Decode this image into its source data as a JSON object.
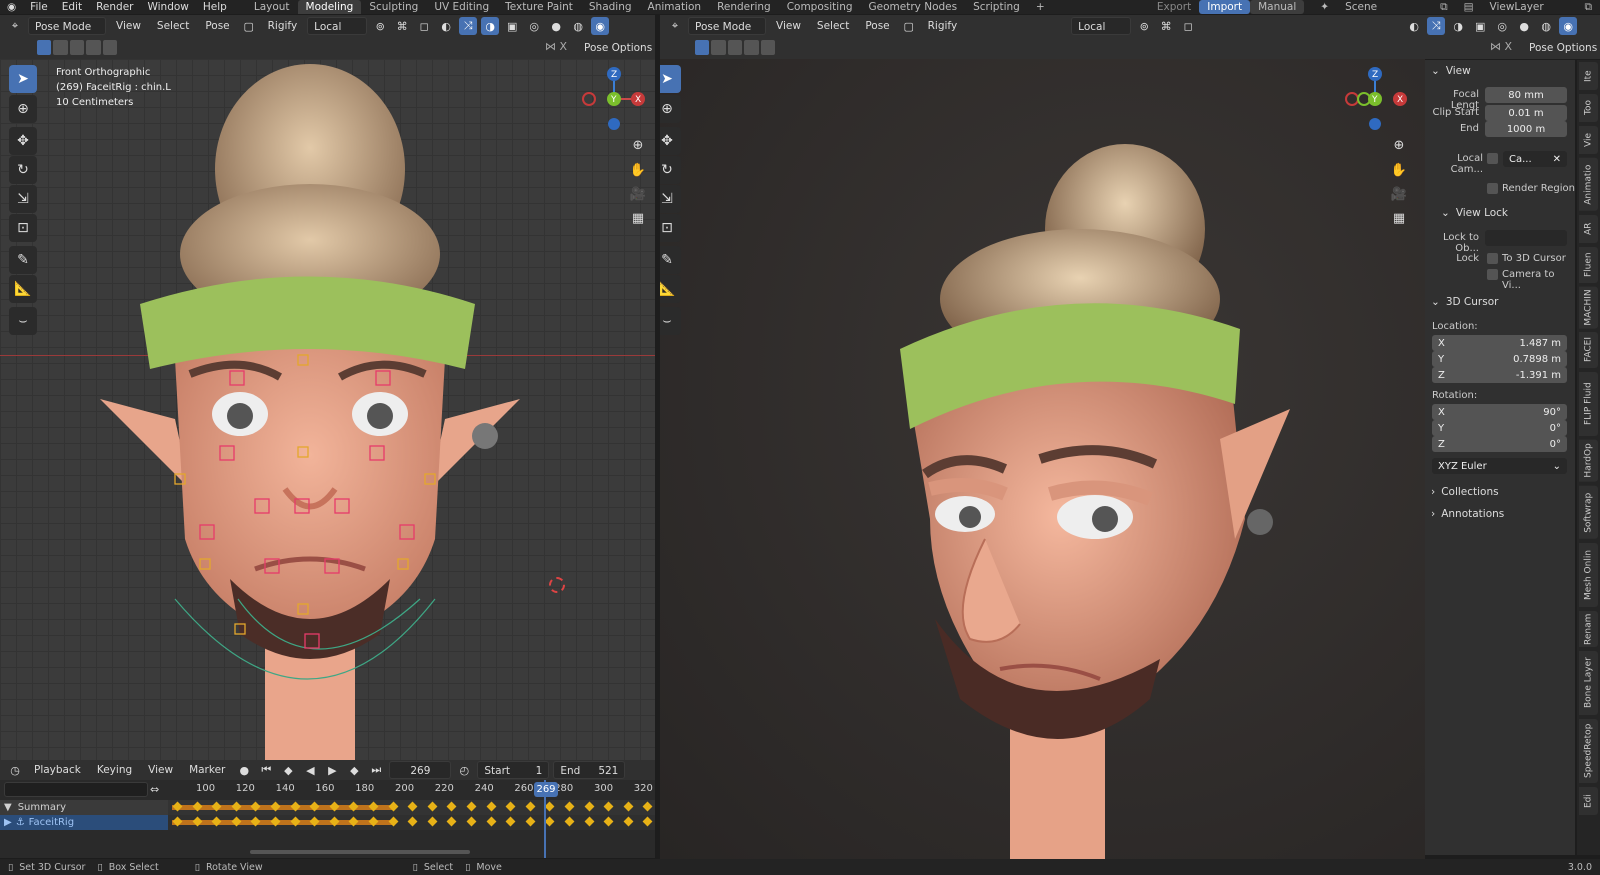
{
  "topbar": {
    "menus": [
      "File",
      "Edit",
      "Render",
      "Window",
      "Help"
    ],
    "workspaces": [
      "Layout",
      "Modeling",
      "Sculpting",
      "UV Editing",
      "Texture Paint",
      "Shading",
      "Animation",
      "Rendering",
      "Compositing",
      "Geometry Nodes",
      "Scripting"
    ],
    "active_workspace": "Modeling",
    "add": "+",
    "export": "Export",
    "import": "Import",
    "manual": "Manual",
    "scene": "Scene",
    "viewlayer": "ViewLayer"
  },
  "left_viewport": {
    "mode": "Pose Mode",
    "menus": [
      "View",
      "Select",
      "Pose",
      "Rigify"
    ],
    "orientation": "Local",
    "pose_options": "Pose Options",
    "overlay_info": [
      "Front Orthographic",
      "(269) FaceitRig : chin.L",
      "10 Centimeters"
    ]
  },
  "right_viewport": {
    "mode": "Pose Mode",
    "menus": [
      "View",
      "Select",
      "Pose",
      "Rigify"
    ],
    "orientation": "Local",
    "pose_options": "Pose Options"
  },
  "n_panel": {
    "view_header": "View",
    "focal_label": "Focal Lengt",
    "focal_value": "80 mm",
    "clip_start_label": "Clip Start",
    "clip_start_value": "0.01 m",
    "end_label": "End",
    "end_value": "1000 m",
    "local_cam_label": "Local Cam...",
    "local_cam_value": "Ca...",
    "render_region": "Render Region",
    "view_lock_header": "View Lock",
    "lock_to_obj": "Lock to Ob...",
    "lock_label": "Lock",
    "to_3d_cursor": "To 3D Cursor",
    "camera_to_view": "Camera to Vi...",
    "cursor_header": "3D Cursor",
    "location_label": "Location:",
    "loc": [
      {
        "axis": "X",
        "value": "1.487 m"
      },
      {
        "axis": "Y",
        "value": "0.7898 m"
      },
      {
        "axis": "Z",
        "value": "-1.391 m"
      }
    ],
    "rotation_label": "Rotation:",
    "rot": [
      {
        "axis": "X",
        "value": "90°"
      },
      {
        "axis": "Y",
        "value": "0°"
      },
      {
        "axis": "Z",
        "value": "0°"
      }
    ],
    "rot_mode": "XYZ Euler",
    "collections": "Collections",
    "annotations": "Annotations"
  },
  "side_tabs": [
    "Ite",
    "Too",
    "Vie",
    "Animatio",
    "AR",
    "Fluen",
    "MACHIN",
    "FACEI",
    "FLIP Fluid",
    "HardOp",
    "Softwrap",
    "Mesh Onlin",
    "Renam",
    "Bone Layer",
    "SpeedRetop",
    "Edi"
  ],
  "timeline": {
    "menus": [
      "Playback",
      "Keying",
      "View",
      "Marker"
    ],
    "current_frame": "269",
    "start_label": "Start",
    "start_value": "1",
    "end_label": "End",
    "end_value": "521",
    "ticks": [
      "100",
      "120",
      "140",
      "160",
      "180",
      "200",
      "220",
      "240",
      "260",
      "280",
      "300",
      "320"
    ],
    "frame_badge": "269",
    "channels": [
      "Summary",
      "FaceitRig"
    ]
  },
  "statusbar": {
    "items": [
      "Set 3D Cursor",
      "Box Select",
      "Rotate View",
      "Select",
      "Move"
    ],
    "version": "3.0.0"
  },
  "colors": {
    "accent": "#4772b3",
    "keyframe": "#e8b217",
    "bg": "#1d1d1d",
    "panel": "#303030"
  }
}
